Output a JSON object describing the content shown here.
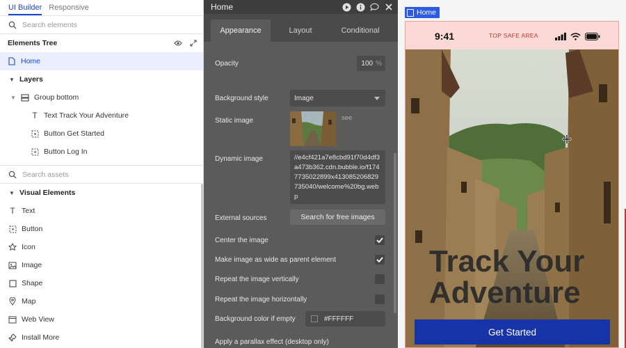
{
  "left_panel": {
    "tabs": [
      "UI Builder",
      "Responsive"
    ],
    "search_elements_placeholder": "Search elements",
    "elements_tree_title": "Elements Tree",
    "home_label": "Home",
    "layers_label": "Layers",
    "group_label": "Group bottom",
    "tree_items": [
      "Text Track Your Adventure",
      "Button Get Started",
      "Button Log In"
    ],
    "search_assets_placeholder": "Search assets",
    "visual_elements_title": "Visual Elements",
    "visual_elements": [
      "Text",
      "Button",
      "Icon",
      "Image",
      "Shape",
      "Map",
      "Web View",
      "Install More"
    ]
  },
  "property_editor": {
    "title": "Home",
    "tabs": [
      "Appearance",
      "Layout",
      "Conditional"
    ],
    "opacity_label": "Opacity",
    "opacity_value": "100",
    "opacity_unit": "%",
    "bg_style_label": "Background style",
    "bg_style_value": "Image",
    "static_image_label": "Static image",
    "see_link": "see",
    "dynamic_image_label": "Dynamic image",
    "dynamic_image_value": "//e4cf421a7e8cbd91f70d4df3a473b362.cdn.bubble.io/f1747735022899x413085206829735040/welcome%20bg.webp",
    "external_sources_label": "External sources",
    "search_free_images_label": "Search for free images",
    "center_image_label": "Center the image",
    "center_image_checked": true,
    "wide_image_label": "Make image as wide as parent element",
    "wide_image_checked": true,
    "repeat_vertical_label": "Repeat the image vertically",
    "repeat_vertical_checked": false,
    "repeat_horizontal_label": "Repeat the image horizontally",
    "repeat_horizontal_checked": false,
    "bg_color_label": "Background color if empty",
    "bg_color_value": "#FFFFFF",
    "parallax_label": "Apply a parallax effect (desktop only)"
  },
  "canvas": {
    "page_badge": "Home",
    "status_time": "9:41",
    "top_safe_area_label": "TOP SAFE AREA",
    "hero_title": "Track Your Adventure",
    "cta_label": "Get Started"
  },
  "colors": {
    "accent": "#1A44D6",
    "cta": "#1633A8",
    "safe_area": "#FBD9D6"
  }
}
